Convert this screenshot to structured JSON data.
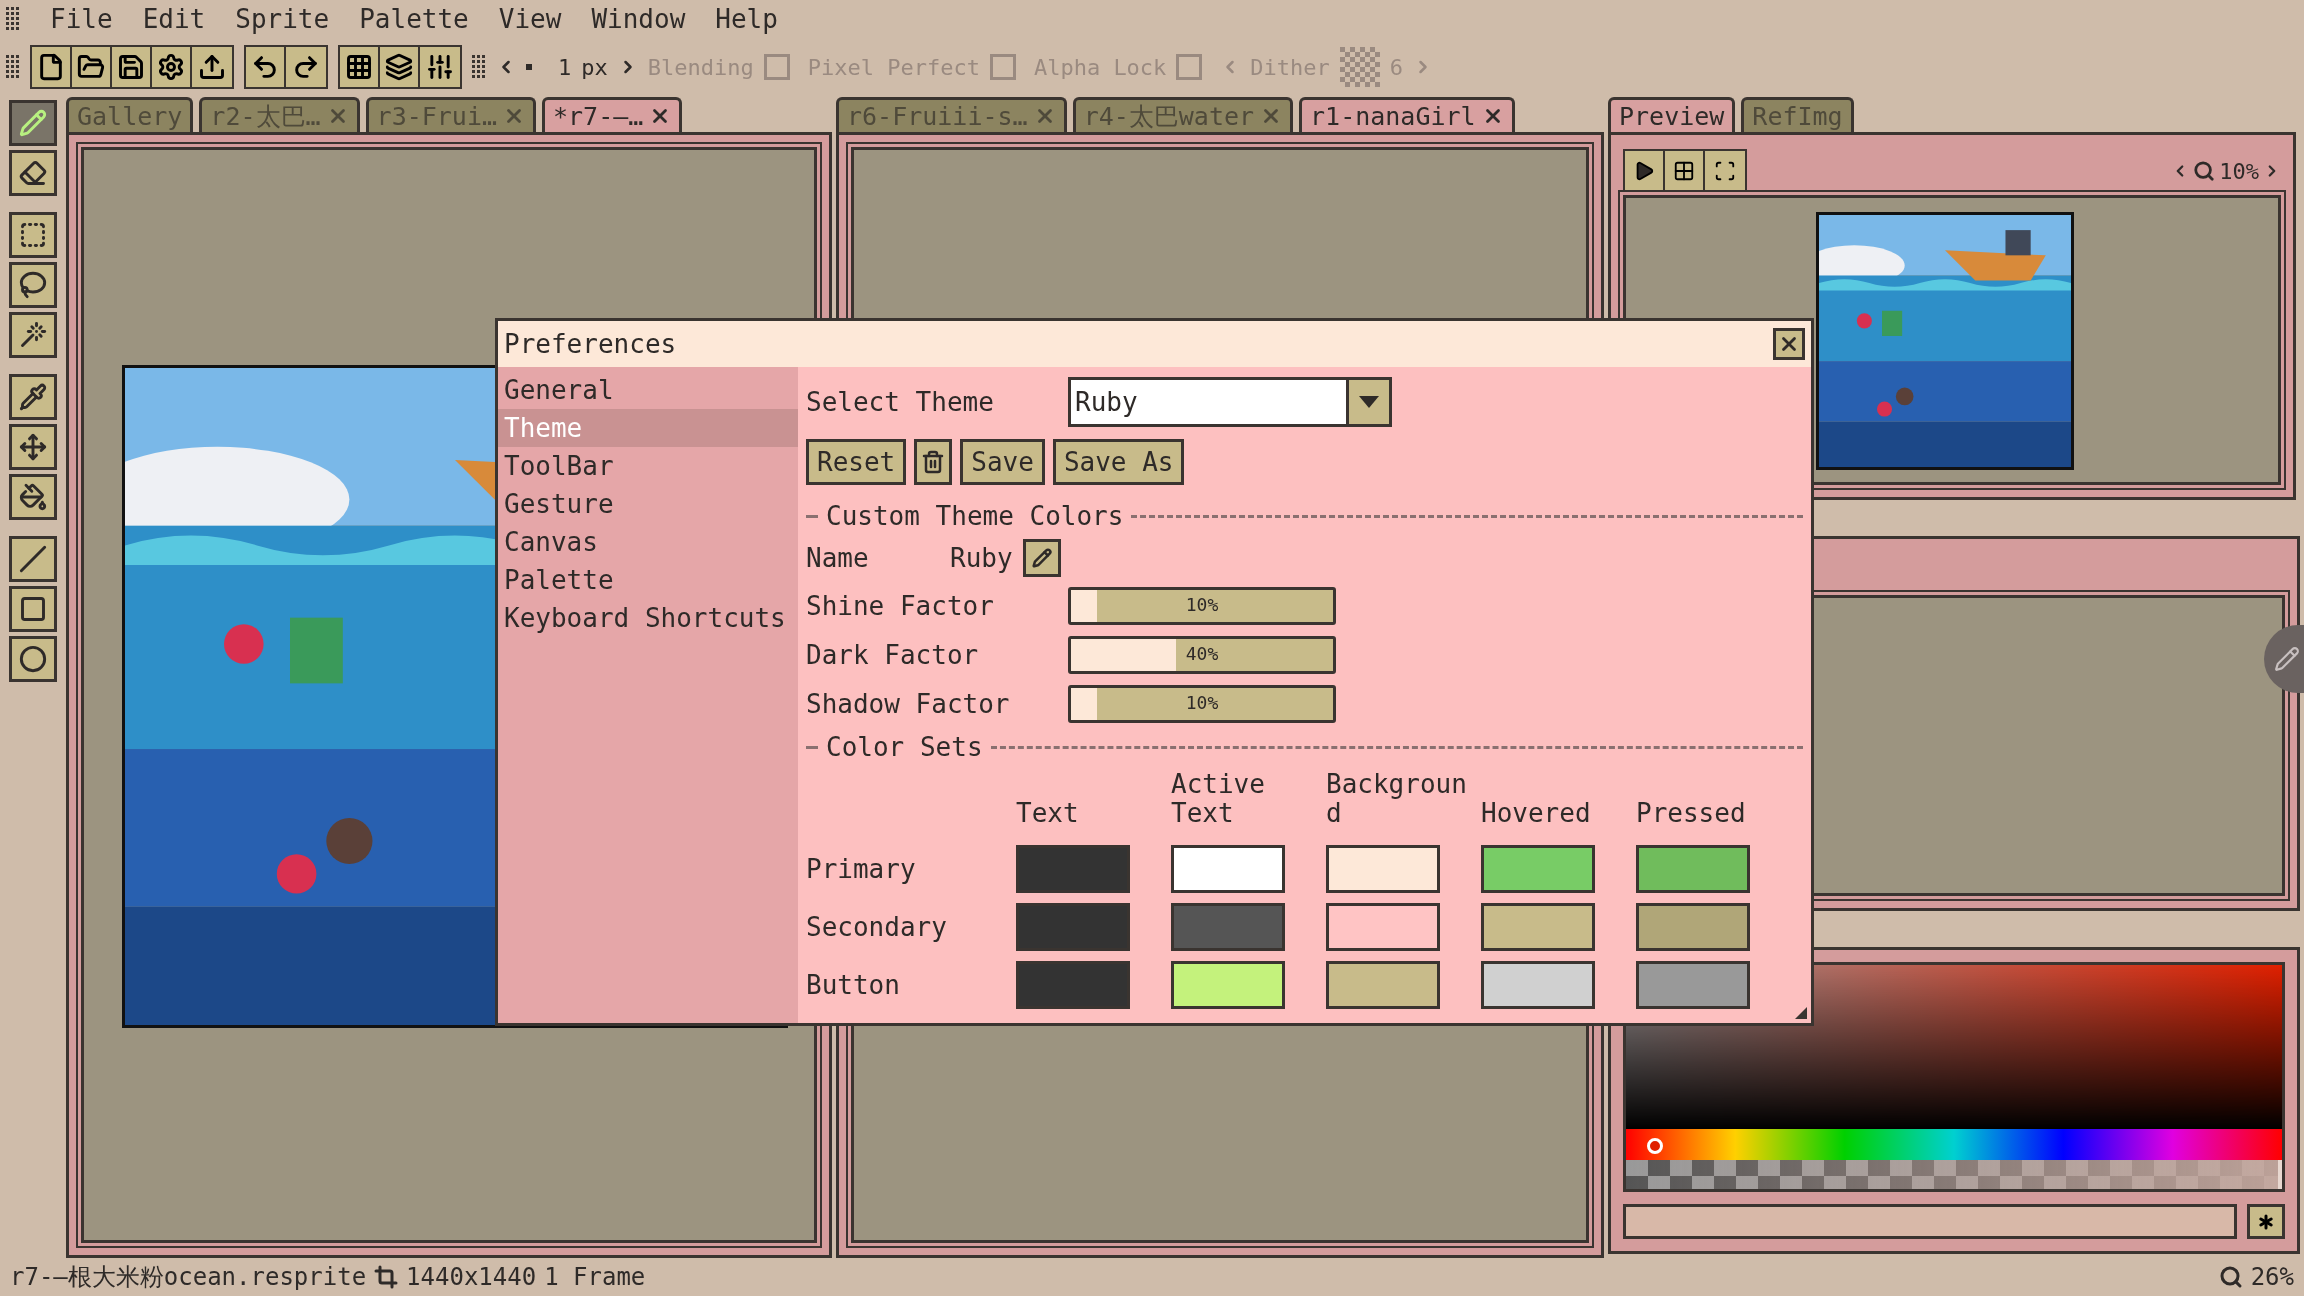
{
  "menu": [
    "File",
    "Edit",
    "Sprite",
    "Palette",
    "View",
    "Window",
    "Help"
  ],
  "toolbar": {
    "brush_size": "1",
    "unit": "px",
    "options": [
      {
        "label": "Blending",
        "checked": false
      },
      {
        "label": "Pixel Perfect",
        "checked": false
      },
      {
        "label": "Alpha Lock",
        "checked": false
      }
    ],
    "dither_label": "Dither",
    "dither_value": "6"
  },
  "tools": [
    {
      "selected": true
    },
    {
      "selected": false
    },
    {
      "selected": false
    },
    {
      "selected": false
    },
    {
      "selected": false
    },
    {
      "selected": false
    },
    {
      "selected": false
    },
    {
      "selected": false
    },
    {
      "selected": false
    },
    {
      "selected": false
    },
    {
      "selected": false
    }
  ],
  "editor_panels": [
    {
      "tabs": [
        {
          "label": "Gallery",
          "closable": false,
          "selected": false
        },
        {
          "label": "r2-太巴…",
          "closable": true,
          "selected": false
        },
        {
          "label": "r3-Frui…",
          "closable": true,
          "selected": false
        },
        {
          "label": "*r7-—…",
          "closable": true,
          "selected": true
        }
      ],
      "canvas": {
        "kind": "picture"
      }
    },
    {
      "tabs": [
        {
          "label": "r6-Fruiii-s…",
          "closable": true,
          "selected": false
        },
        {
          "label": "r4-太巴water",
          "closable": true,
          "selected": false
        },
        {
          "label": "r1-nanaGirl",
          "closable": true,
          "selected": true
        }
      ]
    }
  ],
  "color_picker": {
    "hue": {
      "level": 0.02
    },
    "alpha": {
      "level": 1
    }
  },
  "preview_panel": {
    "tabs": [
      {
        "label": "Preview",
        "closable": false,
        "selected": true
      },
      {
        "label": "RefImg",
        "closable": false,
        "selected": false
      }
    ],
    "zoom": "10%",
    "canvas": {
      "kind": "picture"
    }
  },
  "status_bar": {
    "file": "r7-—根大米粉ocean.resprite",
    "size": "1440x1440",
    "frames": "1 Frame",
    "zoom": "26%"
  },
  "preferences": {
    "title": "Preferences",
    "sections": [
      {
        "label": "General",
        "selected": false
      },
      {
        "label": "Theme",
        "selected": true
      },
      {
        "label": "ToolBar",
        "selected": false
      },
      {
        "label": "Gesture",
        "selected": false
      },
      {
        "label": "Canvas",
        "selected": false
      },
      {
        "label": "Palette",
        "selected": false
      },
      {
        "label": "Keyboard Shortcuts",
        "selected": false
      }
    ],
    "select_theme_label": "Select Theme",
    "theme": "Ruby",
    "reset": "Reset",
    "save": "Save",
    "save_as": "Save As",
    "custom_heading": "Custom Theme Colors",
    "name_label": "Name",
    "name": "Ruby",
    "factors": [
      {
        "label": "Shine Factor",
        "level": 0.1,
        "reading": "10%"
      },
      {
        "label": "Dark Factor",
        "level": 0.4,
        "reading": "40%"
      },
      {
        "label": "Shadow Factor",
        "level": 0.1,
        "reading": "10%"
      }
    ],
    "color_sets_heading": "Color Sets",
    "columns": [
      "Text",
      "Active Text",
      "Background",
      "Hovered",
      "Pressed"
    ],
    "rows": [
      {
        "label": "Primary",
        "swatches": [
          {
            "color": "#333333"
          },
          {
            "color": "#ffffff"
          },
          {
            "color": "#fde8d8"
          },
          {
            "color": "#78cc66"
          },
          {
            "color": "#70bc5c"
          }
        ]
      },
      {
        "label": "Secondary",
        "swatches": [
          {
            "color": "#333333"
          },
          {
            "color": "#555555"
          },
          {
            "color": "#ffc4c4"
          },
          {
            "color": "#c8bb8a"
          },
          {
            "color": "#b0a678"
          }
        ]
      },
      {
        "label": "Button",
        "swatches": [
          {
            "color": "#333333"
          },
          {
            "color": "#c4f27c"
          },
          {
            "color": "#c8bb8a"
          },
          {
            "color": "#d0d0d0"
          },
          {
            "color": "#999999"
          }
        ]
      }
    ]
  }
}
